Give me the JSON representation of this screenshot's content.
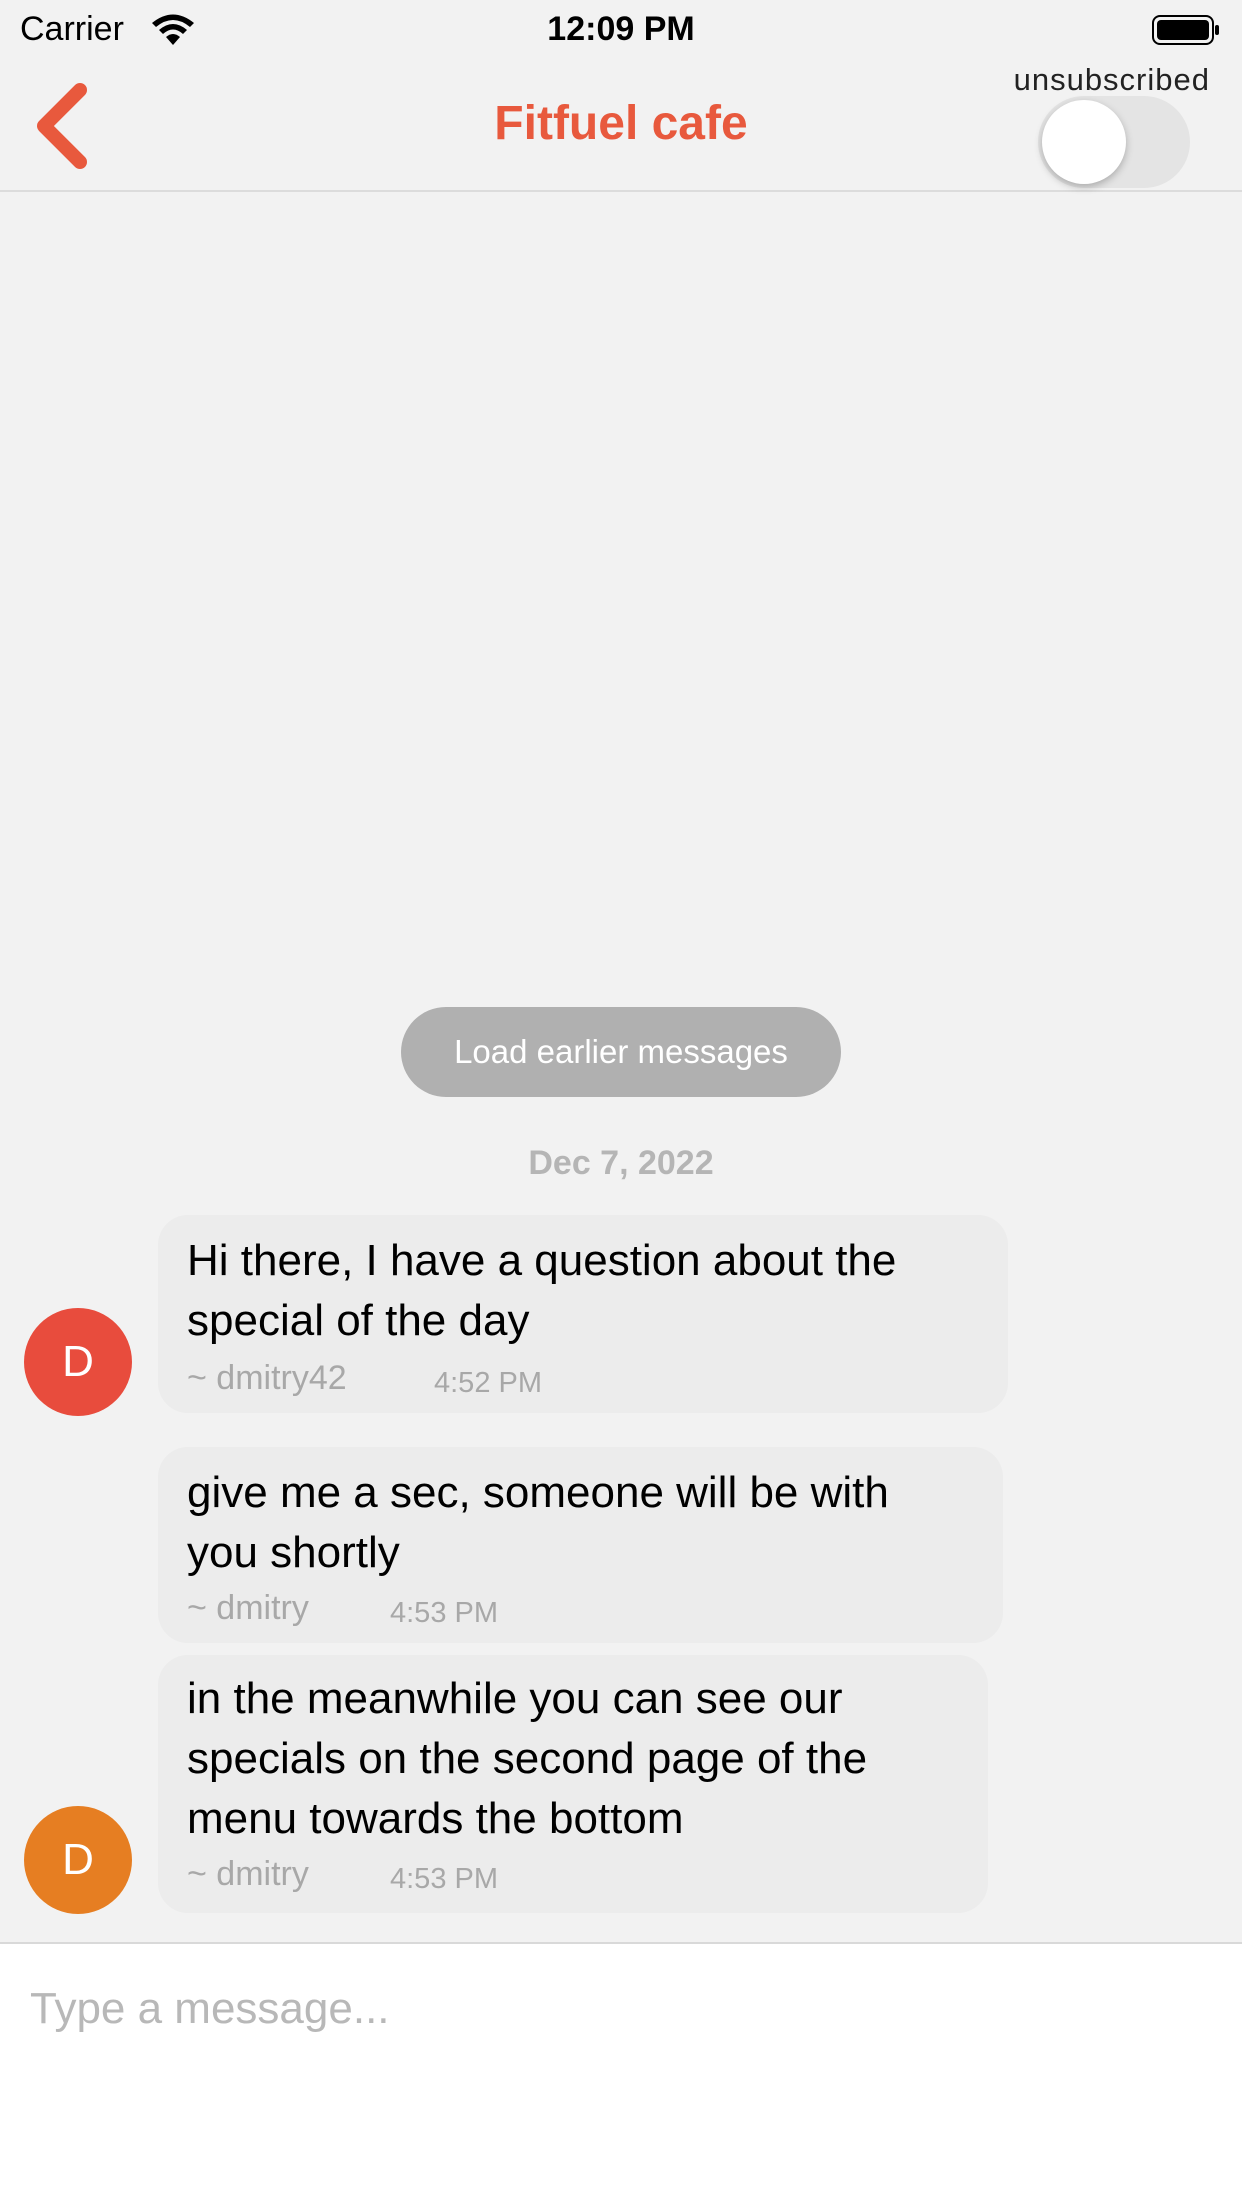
{
  "status_bar": {
    "carrier": "Carrier",
    "time": "12:09 PM",
    "icons": [
      "wifi-icon",
      "battery-icon"
    ]
  },
  "nav": {
    "back_icon": "chevron-left-icon",
    "title": "Fitfuel cafe",
    "subscription_label": "unsubscribed",
    "subscribed": false
  },
  "chat": {
    "load_earlier_label": "Load earlier messages",
    "date": "Dec 7, 2022",
    "messages": [
      {
        "avatar_initial": "D",
        "avatar_color": "#e84c3d",
        "text": [
          "Hi there, I have a question about the",
          "special of the day"
        ],
        "user": "~ dmitry42",
        "time": "4:52 PM"
      },
      {
        "text": [
          "give me a sec, someone will be with",
          "you shortly"
        ],
        "user": "~ dmitry",
        "time": "4:53 PM"
      },
      {
        "avatar_initial": "D",
        "avatar_color": "#e67e22",
        "text": [
          "in the meanwhile you can see our",
          "specials on the second page of the",
          "menu towards the bottom"
        ],
        "user": "~ dmitry",
        "time": "4:53 PM"
      }
    ]
  },
  "composer": {
    "placeholder": "Type a message..."
  },
  "colors": {
    "accent": "#e8593d",
    "background": "#f2f2f2",
    "bubble": "#ececec"
  }
}
